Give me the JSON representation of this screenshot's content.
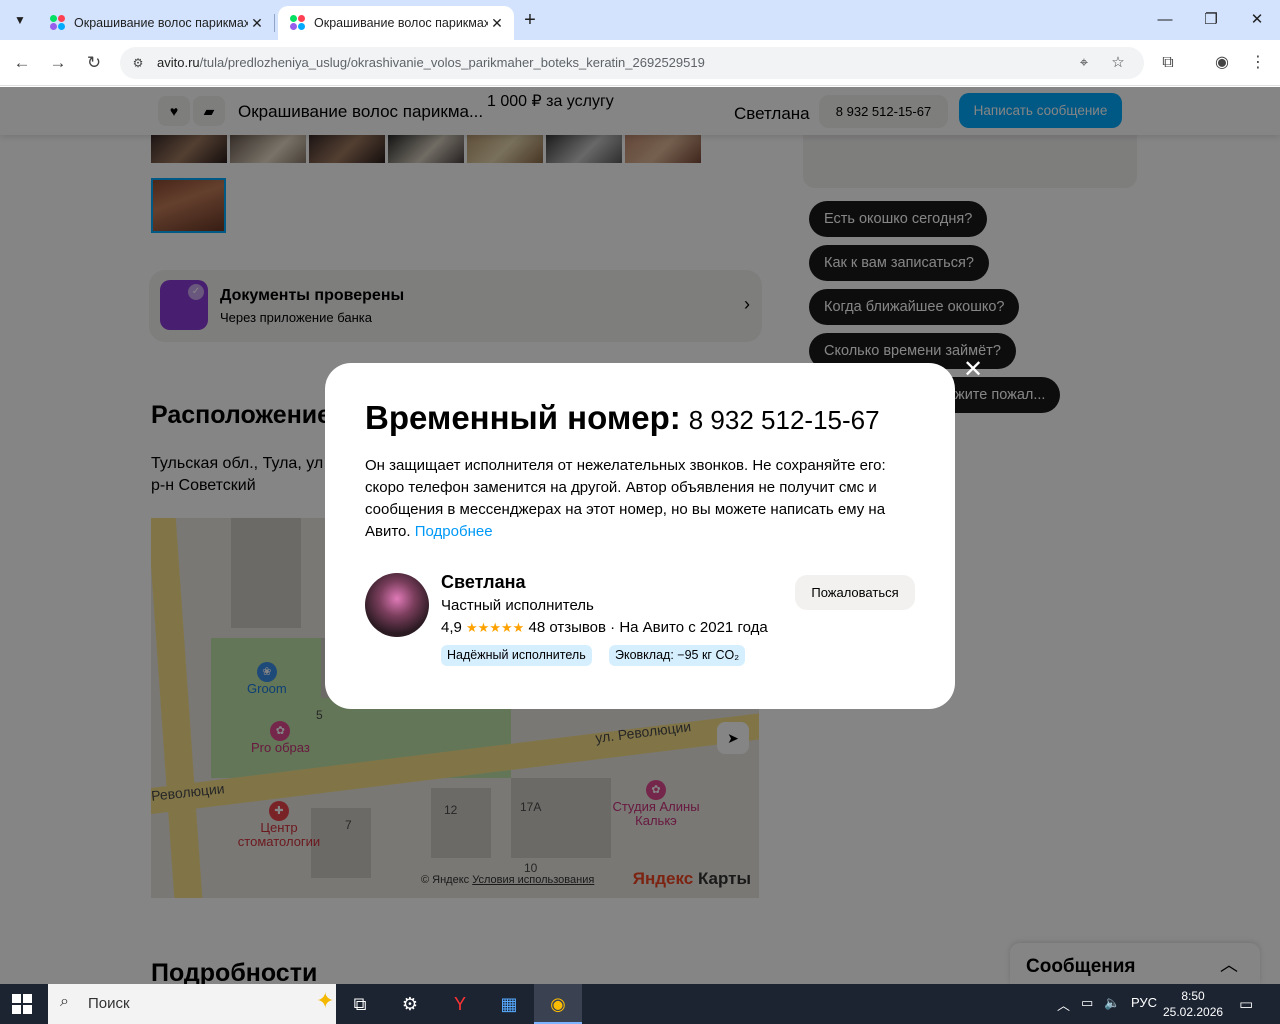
{
  "browser": {
    "tabs": [
      {
        "title": "Окрашивание волос парикмахер",
        "active": false
      },
      {
        "title": "Окрашивание волос парикмахер",
        "active": true
      }
    ],
    "url_host": "avito.ru",
    "url_path": "/tula/predlozheniya_uslug/okrashivanie_volos_parikmaher_boteks_keratin_2692529519"
  },
  "sticky": {
    "title": "Окрашивание волос парикма...",
    "price": "1 000 ₽ за услугу",
    "seller": "Светлана",
    "phone": "8 932 512-15-67",
    "write": "Написать сообщение"
  },
  "docs": {
    "title": "Документы проверены",
    "subtitle": "Через приложение банка"
  },
  "location": {
    "title": "Расположение",
    "address_line1": "Тульская обл., Тула, ул",
    "address_line2": "р-н Советский"
  },
  "map": {
    "labels": {
      "street1": "ул. Революции",
      "street2": "Революции",
      "groom": "Groom",
      "pro": "Pro образ",
      "clinic": "Центр стоматологии",
      "studio": "Студия Алины Калькэ",
      "n5": "5",
      "n7": "7",
      "n12": "12",
      "n17a": "17А",
      "n10": "10"
    },
    "copyright": "© Яндекс",
    "terms": "Условия использования",
    "brand_ya": "Яндекс",
    "brand_maps": "Карты"
  },
  "details_title": "Подробности",
  "chips": [
    "Есть окошко сегодня?",
    "Как к вам записаться?",
    "Когда ближайшее окошко?",
    "Сколько времени займёт?",
    "жите пожал..."
  ],
  "messages_panel": "Сообщения",
  "modal": {
    "heading": "Временный номер:",
    "phone": "8 932 512-15-67",
    "text": "Он защищает исполнителя от нежелательных звонков. Не сохраняйте его: скоро телефон заменится на другой. Автор объявления не получит смс и сообщения в мессенджерах на этот номер, но вы можете написать ему на Авито.",
    "more_link": "Подробнее",
    "seller_name": "Светлана",
    "seller_type": "Частный исполнитель",
    "rating": "4,9",
    "stars": "★★★★★",
    "reviews": "48 отзывов",
    "since": "· На Авито с 2021 года",
    "badges": [
      "Надёжный исполнитель",
      "Эковклад: −95 кг CO₂"
    ],
    "complain": "Пожаловаться"
  },
  "taskbar": {
    "search": "Поиск",
    "lang": "РУС",
    "time": "8:50",
    "date": "25.02.2026"
  }
}
